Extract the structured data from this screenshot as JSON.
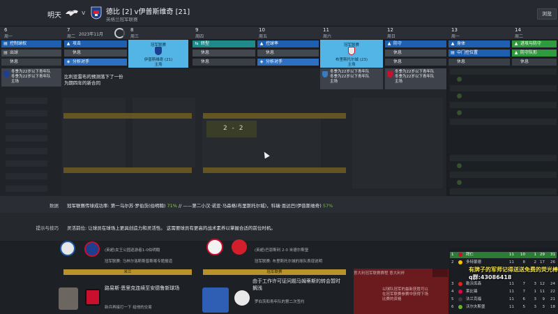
{
  "topbar": {
    "day_label": "明天",
    "vs": "v",
    "title": "德比 [2] v伊普斯维奇 [21]",
    "subtitle": "英格兰冠军联赛",
    "browse": "浏览"
  },
  "calendar": {
    "month": "2023年11月",
    "days": [
      {
        "num": "6",
        "week": "周一"
      },
      {
        "num": "7",
        "week": "周二"
      },
      {
        "num": "8",
        "week": "周三"
      },
      {
        "num": "9",
        "week": "周四"
      },
      {
        "num": "10",
        "week": "周五"
      },
      {
        "num": "11",
        "week": "周六"
      },
      {
        "num": "12",
        "week": "周日"
      },
      {
        "num": "13",
        "week": "周一"
      },
      {
        "num": "14",
        "week": "周二"
      }
    ]
  },
  "schedule": {
    "mon6": [
      "控制球权",
      "出球",
      "休息"
    ],
    "tue7": [
      "攻击",
      "休息",
      "分析对手"
    ],
    "thu9": [
      "转型",
      "休息",
      "休息"
    ],
    "fri10": [
      "控球率",
      "休息",
      "分析对手"
    ],
    "sun12": [
      "防守",
      "休息",
      "休息"
    ],
    "mon13": [
      "身体",
      "中门控位置",
      "休息"
    ],
    "tue14": [
      "进攻与防守",
      "防守队形",
      "休息"
    ]
  },
  "match_wed": {
    "top": "冠军联赛",
    "mid": "伊普斯维奇 (21)",
    "bot": "主场"
  },
  "match_sat": {
    "top": "冠军联赛",
    "mid": "布里斯托尔城 (23)",
    "bot": "主场"
  },
  "notices": {
    "mon": "冬季为22岁以下青年队\n冬季为22岁以下青年队\n主场",
    "sat": "冬季为22岁以下青年队\n冬季为22岁以下青年队\n主场",
    "sun": "冬季为22岁以下青年队\n冬季为22岁以下青年队\n主场"
  },
  "message": "比利亚雷布的预测落下了一份\n为期四年的新合同",
  "score": "2 - 2",
  "info": {
    "stats_label": "数据",
    "stats_text_a": "冠军联赛传球成功率: 第一乌尔苏·罗伯茨(伯明翰) ",
    "stats_pct_a": "71%",
    "stats_text_b": " // ——第二小汉·诺亚·马森格(布里斯托尔城)，科瑞·恩达巴(伊普斯维奇) ",
    "stats_pct_b": "57%",
    "tips_label": "提示与技巧",
    "tips_text_1": "灵活前位: 让球员在球场上更具创造力和灵活性。 这需要球员有更高的战术素养以掌握合适的前位时机。"
  },
  "news": {
    "n1": "(英超)女王公园巡游者1-0伯明翰",
    "n2": "冠军联赛: 马林尔洛斯斯普斯喀专题报道",
    "n3": "(英超)巴恩斯利 2-0 米德尔斯堡",
    "n4": "冠军联赛: 布里斯托尔城的球队表现说明",
    "gold1": "米兰",
    "gold2": "冠军联赛",
    "h1": "路易斯·恩里克连续至安德鲁新球场",
    "h2": "由于工作许可证问题马姆蒂斯的转会暂时\n搁浅",
    "s1": "新兵再接打一下 给他的交易",
    "s2": "罗伯茨和青年队的第二次签约",
    "red_head": "意大利冠军联赛赛程 意大利杯",
    "red_txt": "以球队冠军的最新获胜可以在冠军联赛参赛中获得下场比赛的资格"
  },
  "league_table": [
    {
      "pos": "1",
      "name": "拜仁",
      "v": [
        "11",
        "10",
        "1",
        "29",
        "31"
      ],
      "color": "#c8102e"
    },
    {
      "pos": "2",
      "name": "多特蒙德",
      "v": [
        "11",
        "8",
        "2",
        "17",
        "26"
      ],
      "color": "#f5c400"
    },
    {
      "pos": "3",
      "name": "勒沃库森",
      "v": [
        "11",
        "7",
        "3",
        "12",
        "24"
      ],
      "color": "#e32219"
    },
    {
      "pos": "4",
      "name": "莱比锡",
      "v": [
        "11",
        "7",
        "1",
        "11",
        "22"
      ],
      "color": "#dd0741"
    },
    {
      "pos": "5",
      "name": "法兰克福",
      "v": [
        "11",
        "6",
        "3",
        "9",
        "21"
      ],
      "color": "#1a1a1a"
    },
    {
      "pos": "6",
      "name": "沃尔夫斯堡",
      "v": [
        "11",
        "5",
        "3",
        "3",
        "18"
      ],
      "color": "#65b32e"
    }
  ],
  "overlay": {
    "line1": "有牌子的军师记得送送免费的荧光棒",
    "line2": "q群:43086418"
  }
}
